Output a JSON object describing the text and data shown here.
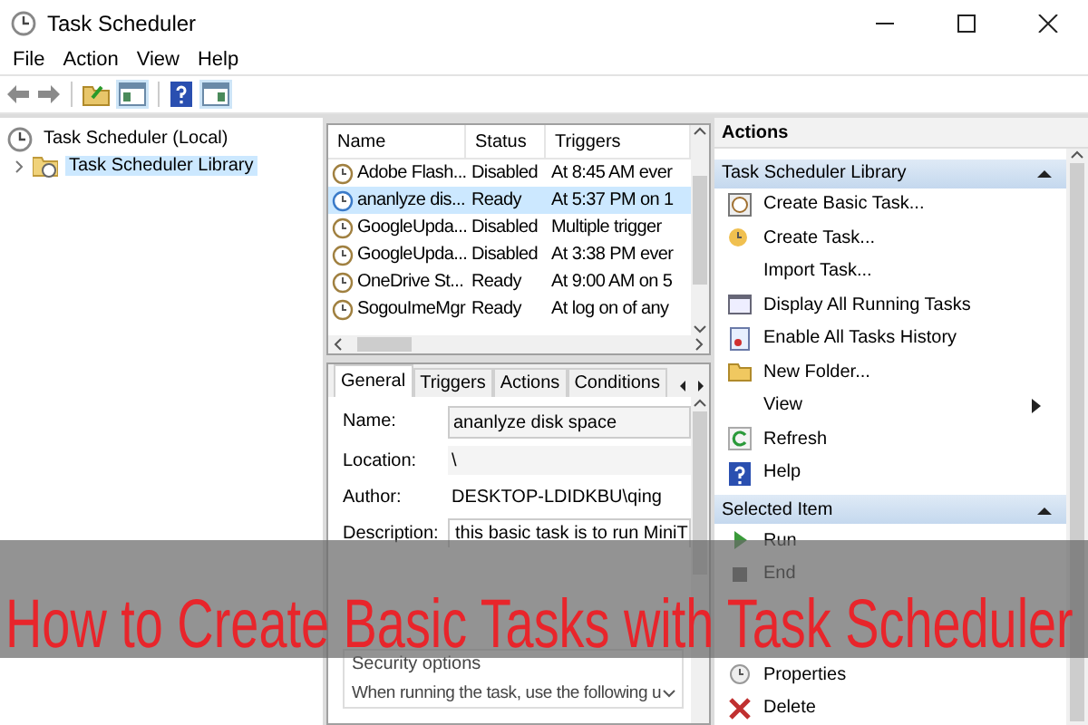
{
  "window": {
    "title": "Task Scheduler"
  },
  "menu": [
    "File",
    "Action",
    "View",
    "Help"
  ],
  "tree": [
    {
      "label": "Task Scheduler (Local)",
      "selected": false,
      "children": [
        {
          "label": "Task Scheduler Library",
          "selected": true
        }
      ]
    }
  ],
  "tasks": {
    "columns": [
      "Name",
      "Status",
      "Triggers"
    ],
    "rows": [
      {
        "name": "Adobe Flash...",
        "status": "Disabled",
        "triggers": "At 8:45 AM ever",
        "selected": false
      },
      {
        "name": "ananlyze dis...",
        "status": "Ready",
        "triggers": "At 5:37 PM on 1",
        "selected": true
      },
      {
        "name": "GoogleUpda...",
        "status": "Disabled",
        "triggers": "Multiple trigger",
        "selected": false
      },
      {
        "name": "GoogleUpda...",
        "status": "Disabled",
        "triggers": "At 3:38 PM ever",
        "selected": false
      },
      {
        "name": "OneDrive St...",
        "status": "Ready",
        "triggers": "At 9:00 AM on 5",
        "selected": false
      },
      {
        "name": "SogouImeMgr",
        "status": "Ready",
        "triggers": "At log on of any",
        "selected": false
      }
    ]
  },
  "details": {
    "tabs": [
      {
        "label": "General",
        "selected": true
      },
      {
        "label": "Triggers",
        "selected": false
      },
      {
        "label": "Actions",
        "selected": false
      },
      {
        "label": "Conditions",
        "selected": false
      }
    ],
    "fields": [
      {
        "kind": "input",
        "label": "Name:",
        "value": "ananlyze disk space"
      },
      {
        "kind": "readonly",
        "label": "Location:",
        "value": "\\"
      },
      {
        "kind": "text",
        "label": "Author:",
        "value": "DESKTOP-LDIDKBU\\qing"
      },
      {
        "kind": "textarea",
        "label": "Description:",
        "value": "this basic task is to run MiniT"
      }
    ],
    "security": {
      "title": "Security options",
      "text": "When running the task, use the following u"
    }
  },
  "actions": {
    "title": "Actions",
    "sections": [
      {
        "title": "Task Scheduler Library",
        "items": [
          {
            "kind": "command",
            "label": "Create Basic Task..."
          },
          {
            "kind": "command",
            "label": "Create Task..."
          },
          {
            "kind": "command",
            "label": "Import Task..."
          },
          {
            "kind": "command",
            "label": "Display All Running Tasks"
          },
          {
            "kind": "command",
            "label": "Enable All Tasks History"
          },
          {
            "kind": "command",
            "label": "New Folder..."
          },
          {
            "kind": "submenu",
            "label": "View"
          },
          {
            "kind": "command",
            "label": "Refresh"
          },
          {
            "kind": "command",
            "label": "Help"
          }
        ]
      },
      {
        "title": "Selected Item",
        "items": [
          {
            "kind": "command",
            "label": "Run"
          },
          {
            "kind": "command",
            "label": "End"
          },
          {
            "kind": "gap"
          },
          {
            "kind": "gap"
          },
          {
            "kind": "command",
            "label": "Properties"
          },
          {
            "kind": "command",
            "label": "Delete"
          }
        ]
      }
    ]
  },
  "banner": {
    "title": "How to Create Basic Tasks with Task Scheduler"
  }
}
